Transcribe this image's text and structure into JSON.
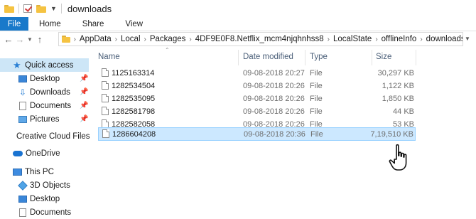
{
  "window": {
    "title": "downloads"
  },
  "ribbon": {
    "file_label": "File",
    "tabs": [
      {
        "label": "Home"
      },
      {
        "label": "Share"
      },
      {
        "label": "View"
      }
    ]
  },
  "address": {
    "overflow": "«",
    "crumbs": [
      {
        "label": "AppData"
      },
      {
        "label": "Local"
      },
      {
        "label": "Packages"
      },
      {
        "label": "4DF9E0F8.Netflix_mcm4njqhnhss8"
      },
      {
        "label": "LocalState"
      },
      {
        "label": "offlineInfo"
      },
      {
        "label": "downloads"
      }
    ]
  },
  "nav": {
    "items": [
      {
        "label": "Quick access",
        "icon": "star-icon",
        "pinned": false
      },
      {
        "label": "Desktop",
        "icon": "desktop-icon",
        "pinned": true
      },
      {
        "label": "Downloads",
        "icon": "download-icon",
        "pinned": true
      },
      {
        "label": "Documents",
        "icon": "document-icon",
        "pinned": true
      },
      {
        "label": "Pictures",
        "icon": "pictures-icon",
        "pinned": true
      },
      {
        "label": "Creative Cloud Files",
        "icon": "creative-cloud-icon",
        "pinned": false
      },
      {
        "label": "OneDrive",
        "icon": "onedrive-icon",
        "pinned": false
      },
      {
        "label": "This PC",
        "icon": "computer-icon",
        "pinned": false
      },
      {
        "label": "3D Objects",
        "icon": "3d-objects-icon",
        "pinned": false
      },
      {
        "label": "Desktop",
        "icon": "desktop-icon",
        "pinned": false
      },
      {
        "label": "Documents",
        "icon": "document-icon",
        "pinned": false
      }
    ]
  },
  "columns": {
    "name": "Name",
    "date": "Date modified",
    "type": "Type",
    "size": "Size"
  },
  "files": [
    {
      "name": "1125163314",
      "date": "09-08-2018 20:27",
      "type": "File",
      "size": "30,297 KB"
    },
    {
      "name": "1282534504",
      "date": "09-08-2018 20:26",
      "type": "File",
      "size": "1,122 KB"
    },
    {
      "name": "1282535095",
      "date": "09-08-2018 20:26",
      "type": "File",
      "size": "1,850 KB"
    },
    {
      "name": "1282581798",
      "date": "09-08-2018 20:26",
      "type": "File",
      "size": "44 KB"
    },
    {
      "name": "1282582058",
      "date": "09-08-2018 20:26",
      "type": "File",
      "size": "53 KB"
    },
    {
      "name": "1286604208",
      "date": "09-08-2018 20:36",
      "type": "File",
      "size": "7,19,510 KB"
    }
  ],
  "colors": {
    "accent": "#1979ca",
    "selection": "#cce8ff",
    "selection_border": "#99d1ff",
    "nav_selected": "#cde6f7",
    "column_header": "#4c607a"
  }
}
